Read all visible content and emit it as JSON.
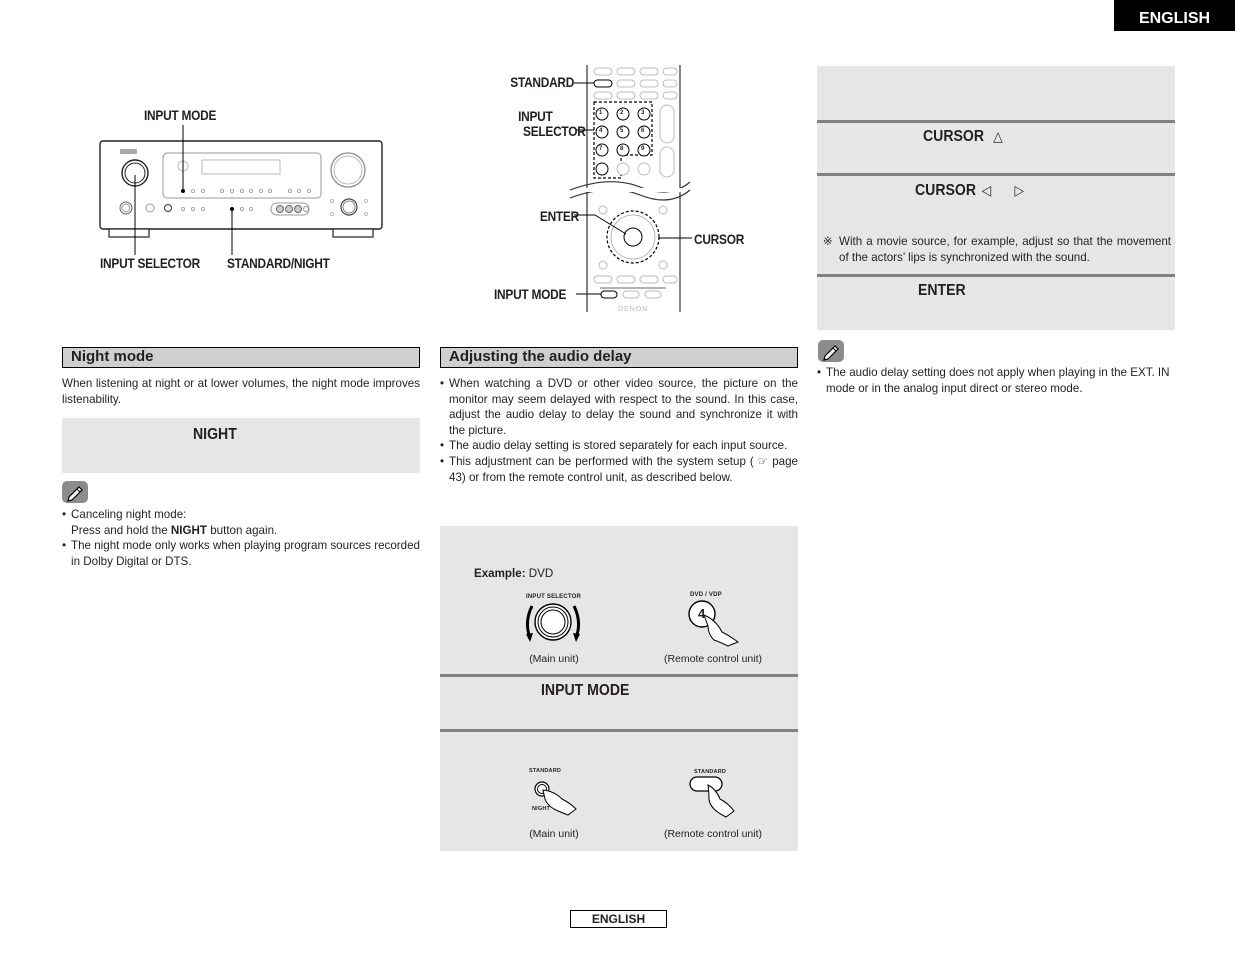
{
  "header": {
    "language_tab": "ENGLISH"
  },
  "footer": {
    "language_label": "ENGLISH"
  },
  "main_unit_diagram": {
    "callouts": {
      "input_mode": "INPUT MODE",
      "input_selector": "INPUT SELECTOR",
      "standard_night": "STANDARD/NIGHT"
    }
  },
  "remote_diagram": {
    "callouts": {
      "standard": "STANDARD",
      "input_selector_line1": "INPUT",
      "input_selector_line2": "SELECTOR",
      "enter": "ENTER",
      "cursor": "CURSOR",
      "input_mode": "INPUT MODE"
    },
    "number_buttons": [
      "1",
      "2",
      "3",
      "4",
      "5",
      "6",
      "7",
      "8",
      "9"
    ],
    "brand": "DENON"
  },
  "night_mode": {
    "heading": "Night mode",
    "intro": "When listening at night or at lower volumes, the night mode improves listenability.",
    "step_label": "NIGHT",
    "notes": [
      {
        "line1": "Canceling night mode:",
        "line2_prefix": "Press and hold the ",
        "line2_bold": "NIGHT",
        "line2_suffix": " button again."
      },
      {
        "text": "The night mode only works when playing program sources recorded in Dolby Digital or DTS."
      }
    ]
  },
  "audio_delay": {
    "heading": "Adjusting the audio delay",
    "bullets": [
      "When watching a DVD or other video source, the picture on the monitor may seem delayed with respect to the sound. In this case, adjust the audio delay to delay the sound and synchronize it with the picture.",
      "The audio delay setting is stored separately for each input source.",
      "This adjustment can be performed with the system setup ( ☞ page 43) or from the remote control unit, as described below."
    ],
    "step1": {
      "example_label": "Example:",
      "example_value": "DVD",
      "main_unit_knob_label": "INPUT SELECTOR",
      "remote_button_label": "DVD / VDP",
      "remote_button_number": "4",
      "main_caption": "(Main unit)",
      "remote_caption": "(Remote control unit)"
    },
    "step2": {
      "label": "INPUT MODE"
    },
    "step3": {
      "main_label_top": "STANDARD",
      "main_label_bottom": "NIGHT",
      "remote_label": "STANDARD",
      "main_caption": "(Main unit)",
      "remote_caption": "(Remote control unit)"
    },
    "right_steps": {
      "cursor_up": {
        "label": "CURSOR",
        "arrow": "△"
      },
      "cursor_lr": {
        "label": "CURSOR",
        "arrow_left": "◁",
        "arrow_right": "▷"
      },
      "footnote_mark": "※",
      "footnote": "With a movie source, for example, adjust so that the movement of the actors’ lips is synchronized with the sound.",
      "enter": {
        "label": "ENTER"
      }
    },
    "note": "The audio delay setting does not apply when playing in the EXT. IN mode or in the analog input direct or stereo mode."
  }
}
